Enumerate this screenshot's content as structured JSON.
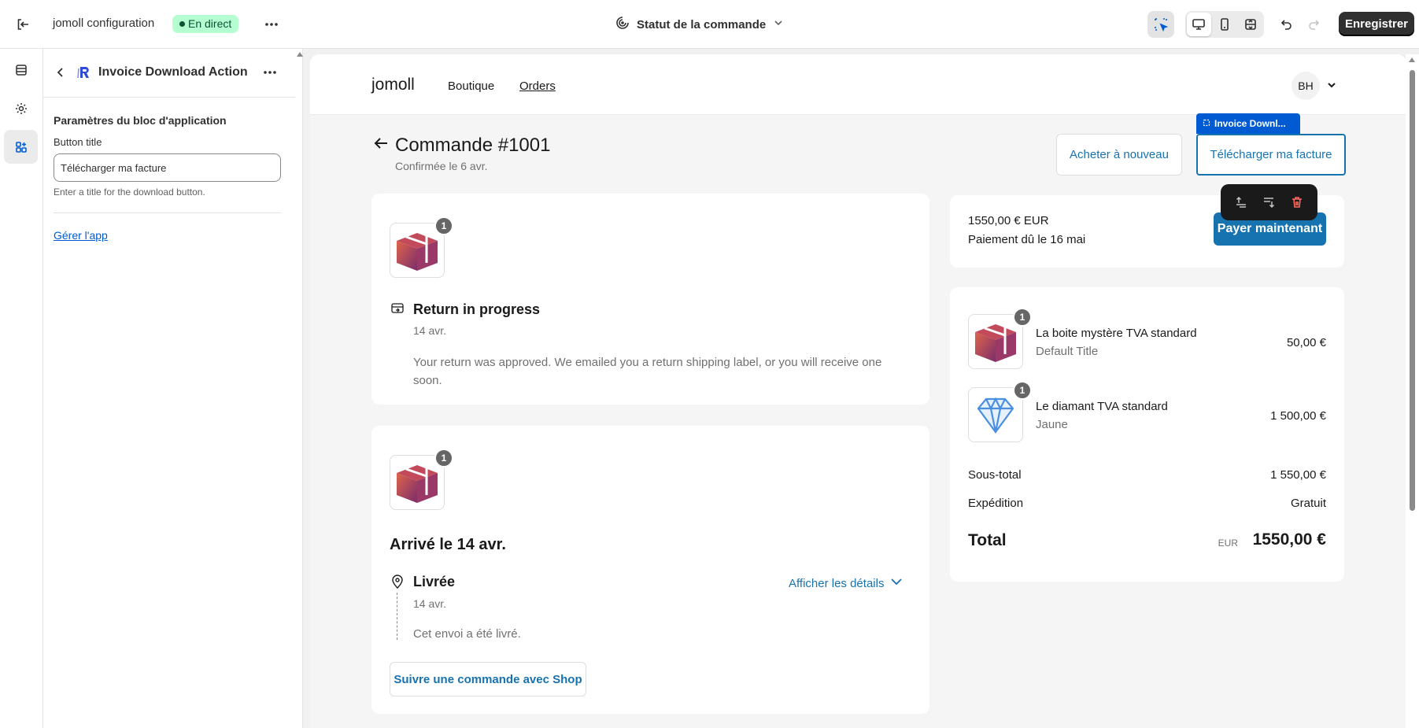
{
  "topbar": {
    "store_name": "jomoll configuration",
    "status_badge": "En direct",
    "template_label": "Statut de la commande",
    "save_label": "Enregistrer"
  },
  "panel": {
    "title": "Invoice Download Action",
    "section_title": "Paramètres du bloc d'application",
    "field_label": "Button title",
    "field_value": "Télécharger ma facture",
    "field_help": "Enter a title for the download button.",
    "manage_link": "Gérer l'app"
  },
  "store": {
    "logo": "jomoll",
    "nav": [
      "Boutique",
      "Orders"
    ],
    "avatar": "BH"
  },
  "order": {
    "title": "Commande #1001",
    "confirmed": "Confirmée le 6 avr.",
    "buy_again": "Acheter à nouveau",
    "download_invoice": "Télécharger ma facture",
    "selected_block_tag": "Invoice Downl..."
  },
  "return_card": {
    "qty": "1",
    "title": "Return in progress",
    "date": "14 avr.",
    "message": "Your return was approved. We emailed you a return shipping label, or you will receive one soon."
  },
  "delivery_card": {
    "qty": "1",
    "heading": "Arrivé le 14 avr.",
    "status": "Livrée",
    "details_link": "Afficher les détails",
    "date": "14 avr.",
    "message": "Cet envoi a été livré.",
    "track_button": "Suivre une commande avec Shop"
  },
  "payment": {
    "amount": "1550,00 € EUR",
    "due": "Paiement dû le 16 mai",
    "pay_button": "Payer maintenant"
  },
  "summary": {
    "items": [
      {
        "name": "La boite mystère TVA standard",
        "variant": "Default Title",
        "price": "50,00 €",
        "qty": "1"
      },
      {
        "name": "Le diamant TVA standard",
        "variant": "Jaune",
        "price": "1 500,00 €",
        "qty": "1"
      }
    ],
    "subtotal_label": "Sous-total",
    "subtotal_value": "1 550,00 €",
    "shipping_label": "Expédition",
    "shipping_value": "Gratuit",
    "total_label": "Total",
    "total_currency": "EUR",
    "total_value": "1550,00 €"
  },
  "colors": {
    "accent": "#1773b0",
    "editor_blue": "#005bd3",
    "badge_bg": "#b4fed2",
    "save_bg": "#303030"
  }
}
